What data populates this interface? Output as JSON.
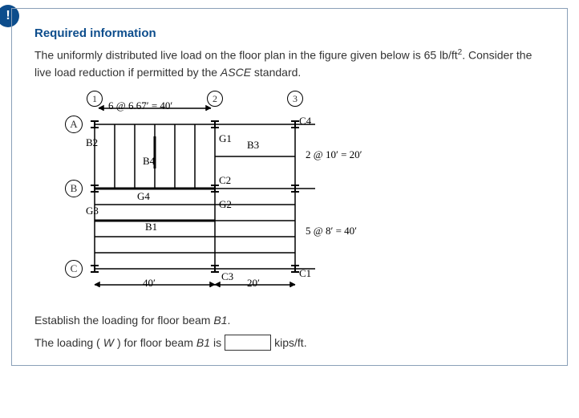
{
  "badge_char": "!",
  "req_title": "Required information",
  "desc_part1": "The uniformly distributed live load on the floor plan in the figure given below is 65 lb/ft",
  "desc_sup": "2",
  "desc_part2": ". Consider the live load reduction if permitted by the ",
  "desc_italic": "ASCE",
  "desc_part3": " standard.",
  "cols": {
    "c1": "1",
    "c2": "2",
    "c3": "3"
  },
  "rows": {
    "a": "A",
    "b": "B",
    "c": "C"
  },
  "top_dim": "6 @ 6.67′ = 40′",
  "right_dim1": "2 @ 10′ = 20′",
  "right_dim2": "5 @ 8′ = 40′",
  "bot_dim1": "40′",
  "bot_dim2": "20′",
  "labels": {
    "B2": "B2",
    "B4": "B4",
    "B3": "B3",
    "G1": "G1",
    "C4": "C4",
    "G4": "G4",
    "C2": "C2",
    "G3": "G3",
    "B1": "B1",
    "G2": "G2",
    "C3": "C3",
    "C1": "C1"
  },
  "prompt1_a": "Establish the loading for floor beam ",
  "prompt1_b": "B1",
  "prompt1_c": ".",
  "prompt2_a": "The loading (",
  "prompt2_w": "W",
  "prompt2_b": ") for floor beam ",
  "prompt2_c": "B1",
  "prompt2_d": " is",
  "prompt2_unit": "kips/ft.",
  "input_value": ""
}
